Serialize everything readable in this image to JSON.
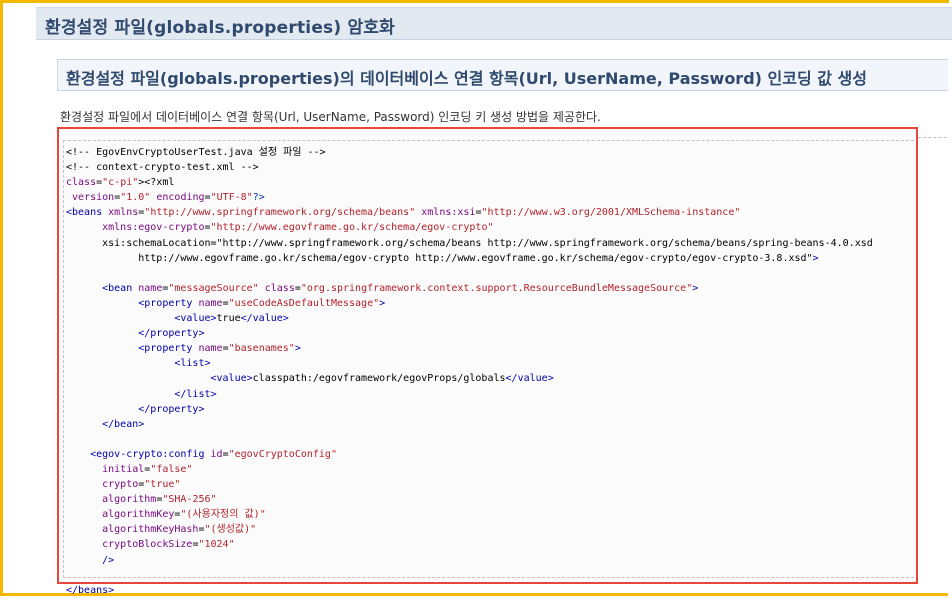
{
  "section": {
    "title": "환경설정 파일(globals.properties) 암호화",
    "subtitle": "환경설정 파일(globals.properties)의 데이터베이스 연결 항목(Url, UserName, Password) 인코딩 값 생성",
    "description": "환경설정 파일에서 데이터베이스 연결 항목(Url, UserName, Password) 인코딩 키 생성 방법을 제공한다."
  },
  "code": {
    "lines": [
      "<!-- EgovEnvCryptoUserTest.java 설정 파일 -->",
      "<!-- context-crypto-test.xml -->",
      "<?xml version=\"1.0\" encoding=\"UTF-8\"?>",
      "<beans xmlns=\"http://www.springframework.org/schema/beans\" xmlns:xsi=\"http://www.w3.org/2001/XMLSchema-instance\"",
      "\txmlns:egov-crypto=\"http://www.egovframe.go.kr/schema/egov-crypto\"",
      "\txsi:schemaLocation=\"http://www.springframework.org/schema/beans http://www.springframework.org/schema/beans/spring-beans-4.0.xsd",
      "\t\thttp://www.egovframe.go.kr/schema/egov-crypto http://www.egovframe.go.kr/schema/egov-crypto/egov-crypto-3.8.xsd\">",
      "",
      "\t<bean name=\"messageSource\" class=\"org.springframework.context.support.ResourceBundleMessageSource\">",
      "\t\t<property name=\"useCodeAsDefaultMessage\">",
      "\t\t\t<value>true</value>",
      "\t\t</property>",
      "\t\t<property name=\"basenames\">",
      "\t\t\t<list>",
      "\t\t\t\t<value>classpath:/egovframework/egovProps/globals</value>",
      "\t\t\t</list>",
      "\t\t</property>",
      "\t</bean>",
      "",
      "    <egov-crypto:config id=\"egovCryptoConfig\"",
      "\tinitial=\"false\"",
      "\tcrypto=\"true\"",
      "\talgorithm=\"SHA-256\"",
      "\talgorithmKey=\"(사용자정의 값)\"",
      "\talgorithmKeyHash=\"(생성값)\"",
      "\tcryptoBlockSize=\"1024\"",
      "\t/>",
      "",
      "</beans>"
    ]
  },
  "colors": {
    "frame": "#f5b800",
    "highlight_border": "#e8453c",
    "heading_bg": "#e2e9f1",
    "heading_text": "#2f4a6e"
  }
}
